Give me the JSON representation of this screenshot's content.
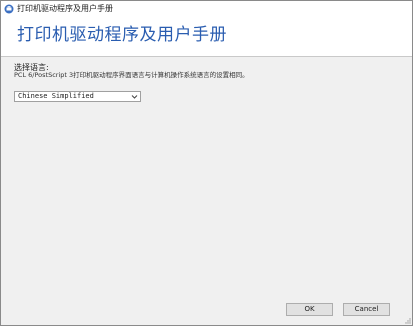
{
  "window": {
    "title": "打印机驱动程序及用户手册"
  },
  "header": {
    "heading": "打印机驱动程序及用户手册"
  },
  "main": {
    "select_language_label": "选择语言:",
    "description": "PCL 6/PostScript 3打印机驱动程序界面语言与计算机操作系统语言的设置相同。",
    "language_dropdown": {
      "selected": "Chinese Simplified"
    }
  },
  "footer": {
    "ok_label": "OK",
    "cancel_label": "Cancel"
  },
  "icons": {
    "app": "printer-app-icon",
    "dropdown": "chevron-down-icon",
    "resize": "resize-grip-icon"
  },
  "colors": {
    "heading": "#2a5db0",
    "background": "#f0f0f0"
  }
}
